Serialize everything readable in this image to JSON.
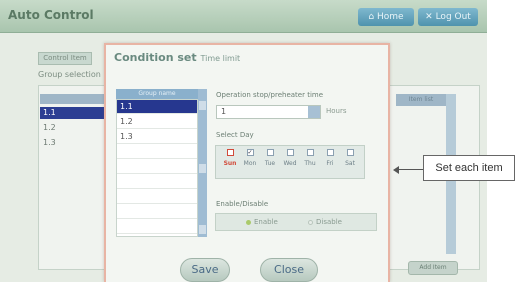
{
  "window": {
    "title": "Auto Control"
  },
  "header": {
    "home_label": "Home",
    "logout_label": "Log Out"
  },
  "background": {
    "tab_label": "Control Item",
    "group_label": "Group selection",
    "list_header": "Group name",
    "rows": [
      "1.1",
      "1.2",
      "1.3"
    ],
    "right_header": "Item list",
    "bottom_button": "Add Item"
  },
  "dialog": {
    "title": "Condition set",
    "subtitle": "Time limit",
    "group_list": {
      "header": "Group name",
      "items": [
        "1.1",
        "1.2",
        "1.3"
      ],
      "selected_index": 0
    },
    "time": {
      "label": "Operation stop/preheater time",
      "value": "1",
      "unit": "Hours"
    },
    "days": {
      "label": "Select Day",
      "items": [
        "Sun",
        "Mon",
        "Tue",
        "Wed",
        "Thu",
        "Fri",
        "Sat"
      ],
      "checked": [
        false,
        true,
        false,
        false,
        false,
        false,
        false
      ]
    },
    "enable": {
      "label": "Enable/Disable",
      "enable_option": "Enable",
      "disable_option": "Disable",
      "selected": "Enable"
    },
    "buttons": {
      "save_label": "Save",
      "close_label": "Close"
    }
  },
  "callout": {
    "text": "Set each item"
  }
}
